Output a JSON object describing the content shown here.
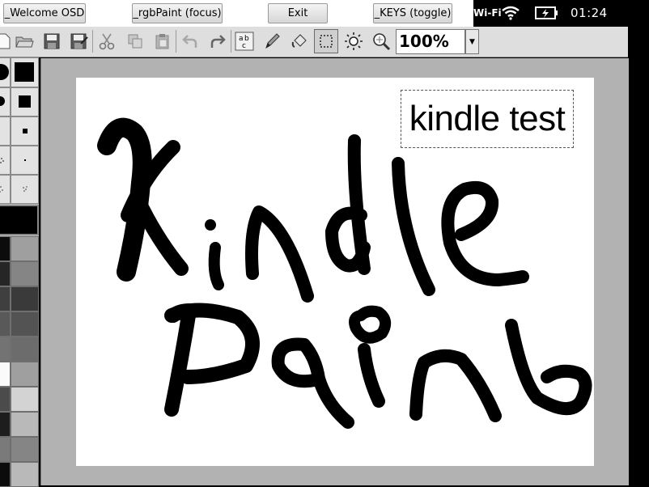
{
  "osd": {
    "buttons": [
      {
        "label": "_Welcome OSD"
      },
      {
        "label": "_rgbPaint (focus)"
      },
      {
        "label": "Exit"
      },
      {
        "label": "_KEYS (toggle)"
      }
    ]
  },
  "status": {
    "wifi_label": "Wi-Fi",
    "time": "01:24",
    "icons": [
      "wifi-icon",
      "battery-charging-icon"
    ]
  },
  "toolbar": {
    "tools": [
      "new-file-icon",
      "open-folder-icon",
      "save-icon",
      "save-as-icon",
      "cut-icon",
      "copy-icon",
      "paste-icon",
      "undo-icon",
      "redo-icon",
      "text-tool-icon",
      "pencil-icon",
      "fill-icon",
      "select-rectangle-icon",
      "brightness-icon",
      "zoom-icon"
    ],
    "active_tool": "select-rectangle-icon",
    "zoom_value": "100%"
  },
  "canvas": {
    "text_box": "kindle test",
    "drawing": "hand-drawn text: Kindle Paint"
  },
  "colors": {
    "palette_grays": [
      "#1e1e1e",
      "#3a3a3a",
      "#535353",
      "#6c6c6c",
      "#858585",
      "#9f9f9f",
      "#b9b9b9",
      "#d3d3d3",
      "#fafafa"
    ]
  }
}
